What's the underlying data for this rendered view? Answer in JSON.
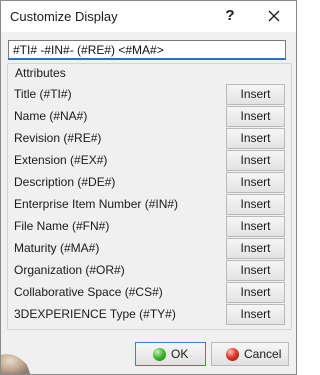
{
  "window": {
    "title": "Customize Display",
    "help_label": "?"
  },
  "format_field": {
    "value": "#TI# -#IN#- (#RE#) <#MA#>"
  },
  "attributes": {
    "legend": "Attributes",
    "insert_label": "Insert",
    "items": [
      {
        "label": "Title (#TI#)"
      },
      {
        "label": "Name (#NA#)"
      },
      {
        "label": "Revision (#RE#)"
      },
      {
        "label": "Extension (#EX#)"
      },
      {
        "label": "Description (#DE#)"
      },
      {
        "label": "Enterprise Item Number (#IN#)"
      },
      {
        "label": "File Name (#FN#)"
      },
      {
        "label": "Maturity (#MA#)"
      },
      {
        "label": "Organization (#OR#)"
      },
      {
        "label": "Collaborative Space (#CS#)"
      },
      {
        "label": "3DEXPERIENCE Type (#TY#)"
      }
    ]
  },
  "footer": {
    "ok_label": "OK",
    "cancel_label": "Cancel"
  },
  "colors": {
    "accent": "#2f6fc2",
    "dialog_bg": "#f0f0f0",
    "ok_icon": "#47b93a",
    "cancel_icon": "#e0382b"
  }
}
